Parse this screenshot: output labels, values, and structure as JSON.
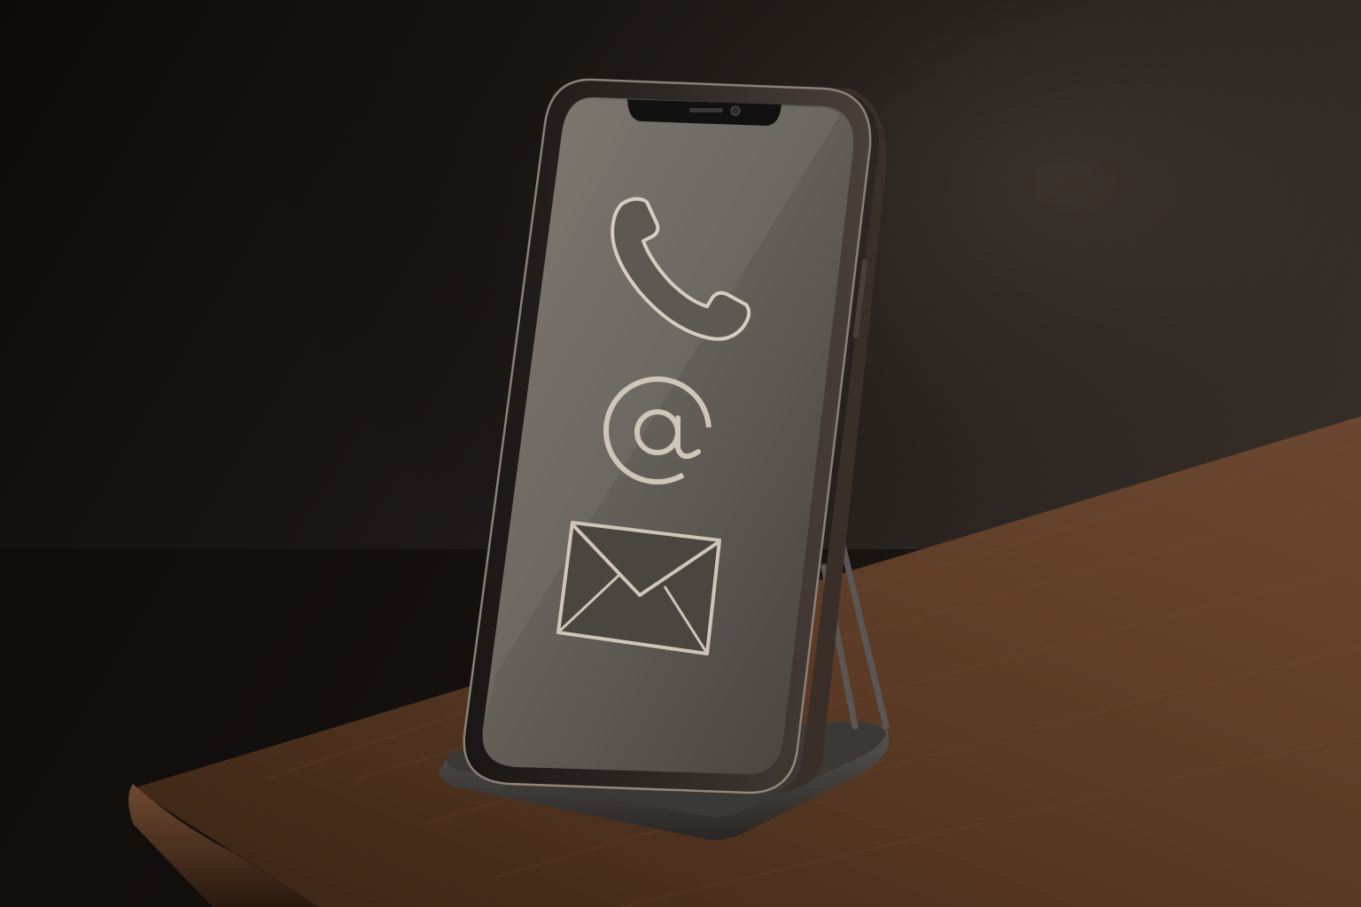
{
  "scene": {
    "subject": "smartphone-on-stand",
    "screen_icons": [
      "phone-handset-icon",
      "at-sign-icon",
      "envelope-icon"
    ],
    "at_glyph": "@",
    "colors": {
      "wall_dark": "#0e0b0a",
      "wall_light": "#3a312b",
      "table_top": "#5a3a26",
      "table_edge": "#3a2416",
      "phone_frame": "#2a2522",
      "screen": "#6b645c",
      "icon_stroke": "#d8cfc2",
      "stand_metal": "#4a4542"
    }
  }
}
